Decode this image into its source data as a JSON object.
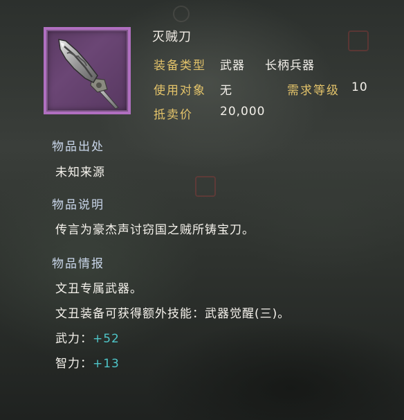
{
  "item": {
    "name": "灭贼刀",
    "icon": "glaive-blade-icon",
    "frame_color": "#b06fc0"
  },
  "attributes": {
    "equip_type_label": "装备类型",
    "equip_type_value1": "武器",
    "equip_type_value2": "长柄兵器",
    "target_label": "使用对象",
    "target_value": "无",
    "level_label": "需求等级",
    "level_value": "10",
    "price_label": "抵卖价",
    "price_value": "20,000"
  },
  "sections": {
    "origin_title": "物品出处",
    "origin_text": "未知来源",
    "desc_title": "物品说明",
    "desc_text": "传言为豪杰声讨窃国之贼所铸宝刀。",
    "info_title": "物品情报",
    "info_line1": "文丑专属武器。",
    "info_line2": "文丑装备可获得额外技能：武器觉醒(三)。",
    "stat1_label": "武力：",
    "stat1_value": "+52",
    "stat2_label": "智力：",
    "stat2_value": "+13"
  },
  "colors": {
    "label": "#e3c36a",
    "section_title": "#c9d6ea",
    "stat_bonus": "#4fc6c9"
  }
}
